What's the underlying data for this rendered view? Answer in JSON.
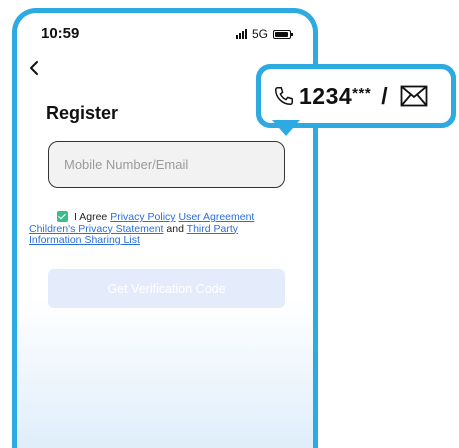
{
  "status_bar": {
    "time": "10:59",
    "network": "5G"
  },
  "page": {
    "title": "Register"
  },
  "form": {
    "account_placeholder": "Mobile Number/Email",
    "agree_checked": true,
    "agree_prefix": "I Agree",
    "privacy_policy": "Privacy Policy",
    "user_agreement": "User Agreement",
    "childrens_privacy": "Children's Privacy Statement",
    "and": "and",
    "third_party": "Third Party Information Sharing List",
    "submit_label": "Get Verification Code"
  },
  "callout": {
    "phone_digits": "1234",
    "masked": "***",
    "separator": "/",
    "icons": [
      "phone-icon",
      "envelope-icon"
    ]
  },
  "colors": {
    "accent": "#2daae1",
    "checkbox": "#3ebd8c",
    "link": "#2a6fd6",
    "button_disabled": "#e4ecfb"
  }
}
